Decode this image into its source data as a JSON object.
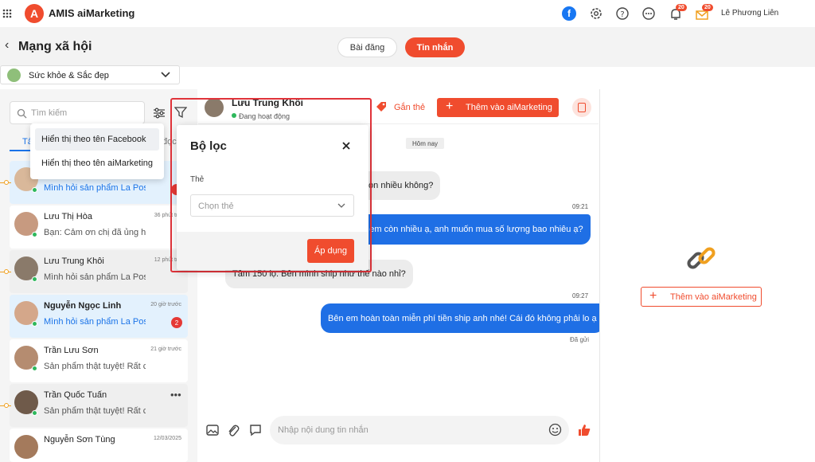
{
  "app": {
    "name": "AMIS aiMarketing",
    "logo_letter": "A",
    "accent": "#f04c2e"
  },
  "topbar": {
    "notif_count": "20",
    "mail_count": "20",
    "user_name": "Lê Phương Liên"
  },
  "page": {
    "title": "Mạng xã hội",
    "tabs": [
      "Bài đăng",
      "Tin nhắn"
    ],
    "active_tab": "Tin nhắn"
  },
  "category": {
    "selected": "Sức khỏe & Sắc đẹp"
  },
  "search": {
    "placeholder": "Tìm kiếm"
  },
  "list_tabs": {
    "first": "Tấ",
    "second": "đọc"
  },
  "name_menu": {
    "items": [
      "Hiển thị theo tên Facebook",
      "Hiển thị theo tên aiMarketing"
    ]
  },
  "conversations": [
    {
      "name": "",
      "message": "Mình hỏi sản phẩm La Poss",
      "time": "",
      "unread": ""
    },
    {
      "name": "Lưu Thị Hòa",
      "message": "Bạn: Cảm ơn chị đã ủng hộ",
      "time": "36 phút trư",
      "unread": ""
    },
    {
      "name": "Lưu Trung Khôi",
      "message": "Mình hỏi sản phẩm La Poss",
      "time": "12 phút trư",
      "unread": ""
    },
    {
      "name": "Nguyễn Ngọc Linh",
      "message": "Mình hỏi sản phẩm La Poss",
      "time": "20 giờ trước",
      "unread": "2"
    },
    {
      "name": "Trần Lưu Sơn",
      "message": "Sản phẩm thật tuyệt! Rất cả",
      "time": "21 giờ trước",
      "unread": ""
    },
    {
      "name": "Trần Quốc Tuấn",
      "message": "Sản phẩm thật tuyệt! Rất cả",
      "time": "",
      "unread": ""
    },
    {
      "name": "Nguyễn Sơn Tùng",
      "message": "",
      "time": "12/03/2025",
      "unread": ""
    }
  ],
  "chat": {
    "contact_name": "Lưu Trung Khôi",
    "status": "Đang hoạt động",
    "tag_label": "Gắn thẻ",
    "add_label": "Thêm vào aiMarketing",
    "date_chip": "Hôm nay",
    "messages": [
      {
        "dir": "in",
        "text": "y còn nhiều không?",
        "time": ""
      },
      {
        "dir": "out",
        "text": "ên em còn nhiều ạ, anh muốn mua số lượng bao nhiêu ạ?",
        "time": "09:21"
      },
      {
        "dir": "in",
        "text": "Tầm 150 lọ. Bên mình ship như thế nào nhỉ?",
        "time": ""
      },
      {
        "dir": "out",
        "text": "Bên em hoàn toàn miễn phí tiền ship anh nhé! Cái đó không phải lo ạ",
        "time": "09:27"
      }
    ],
    "sent_label": "Đã gửi",
    "input_placeholder": "Nhập nội dung tin nhắn"
  },
  "filter_dialog": {
    "title": "Bộ lọc",
    "field_label": "Thẻ",
    "select_placeholder": "Chọn thẻ",
    "apply_label": "Áp dụng"
  },
  "right_panel": {
    "add_label": "Thêm vào aiMarketing"
  }
}
